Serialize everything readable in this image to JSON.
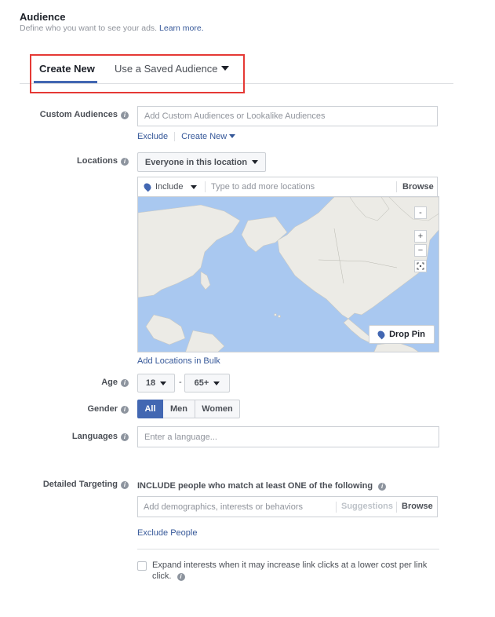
{
  "header": {
    "title": "Audience",
    "subtitle": "Define who you want to see your ads.",
    "learn_more": "Learn more."
  },
  "tabs": {
    "create_new": "Create New",
    "saved_audience": "Use a Saved Audience"
  },
  "custom_audiences": {
    "label": "Custom Audiences",
    "placeholder": "Add Custom Audiences or Lookalike Audiences",
    "exclude": "Exclude",
    "create_new": "Create New"
  },
  "locations": {
    "label": "Locations",
    "dropdown": "Everyone in this location",
    "include": "Include",
    "placeholder": "Type to add more locations",
    "browse": "Browse",
    "drop_pin": "Drop Pin",
    "add_bulk": "Add Locations in Bulk",
    "zoom_in": "+",
    "zoom_out": "−",
    "collapse": "-"
  },
  "age": {
    "label": "Age",
    "min": "18",
    "separator": "-",
    "max": "65+"
  },
  "gender": {
    "label": "Gender",
    "options": [
      "All",
      "Men",
      "Women"
    ],
    "selected": "All"
  },
  "languages": {
    "label": "Languages",
    "placeholder": "Enter a language..."
  },
  "detailed_targeting": {
    "label": "Detailed Targeting",
    "include_prefix": "INCLUDE",
    "include_text": "people who match at least ONE of the following",
    "placeholder": "Add demographics, interests or behaviors",
    "suggestions": "Suggestions",
    "browse": "Browse",
    "exclude_people": "Exclude People",
    "expand_text": "Expand interests when it may increase link clicks at a lower cost per link click.",
    "expand_checked": false
  },
  "colors": {
    "accent": "#4267b2",
    "link": "#365899",
    "highlight_box": "#e53935",
    "map_water": "#a9c8f0",
    "map_land": "#ecebe6"
  }
}
